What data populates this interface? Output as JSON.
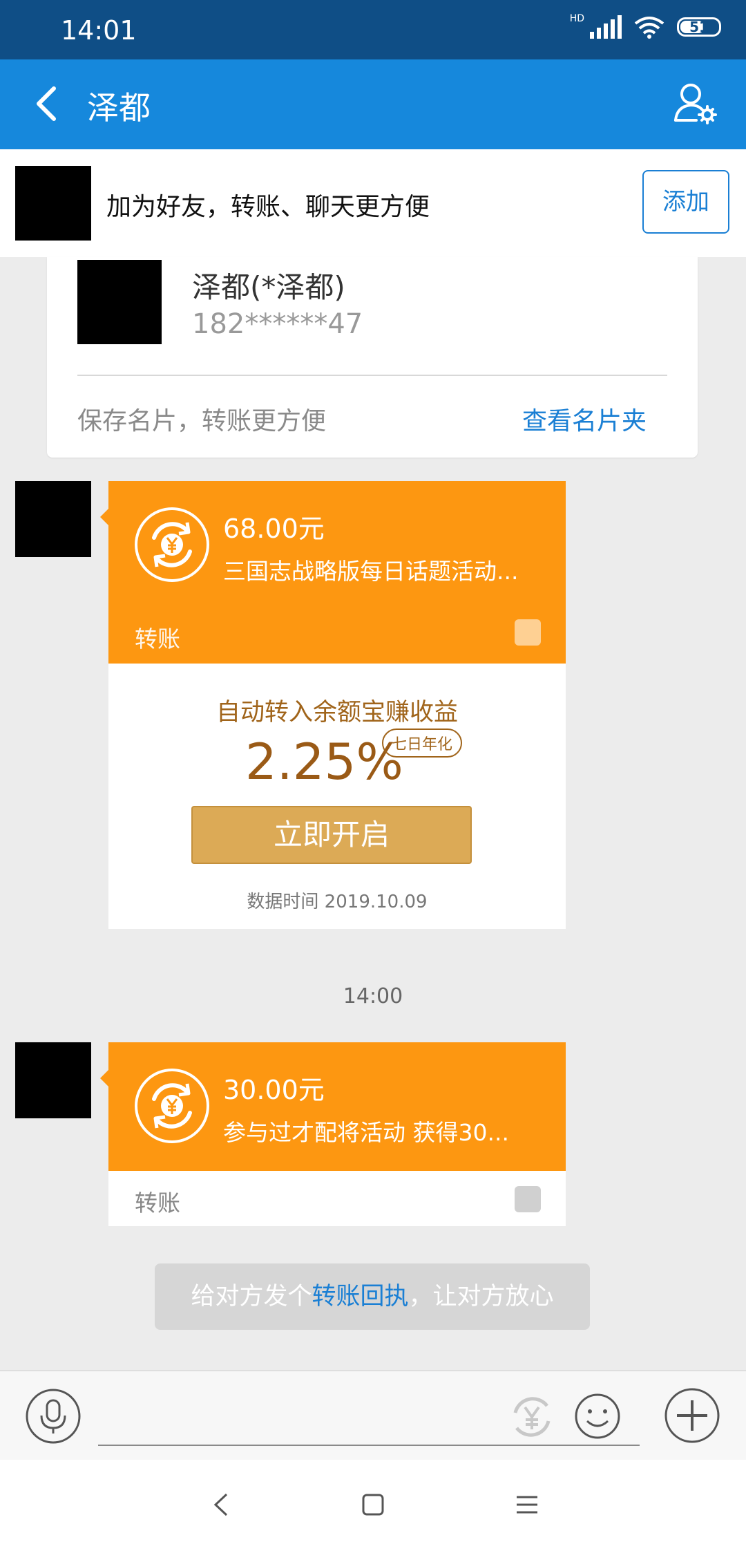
{
  "status_bar": {
    "time": "14:01",
    "network": "HD",
    "battery": "51"
  },
  "header": {
    "title": "泽都"
  },
  "friend_banner": {
    "text": "加为好友，转账、聊天更方便",
    "add_label": "添加"
  },
  "name_card": {
    "name": "泽都(*泽都)",
    "phone": "182******47",
    "save_text": "保存名片，转账更方便",
    "view_link": "查看名片夹"
  },
  "messages": [
    {
      "amount": "68.00元",
      "description": "三国志战略版每日话题活动...",
      "type_label": "转账",
      "promo": {
        "headline": "自动转入余额宝赚收益",
        "rate": "2.25%",
        "badge": "七日年化",
        "button": "立即开启",
        "data_time": "数据时间 2019.10.09"
      }
    },
    {
      "timestamp": "14:00",
      "amount": "30.00元",
      "description": "参与过才配将活动 获得30...",
      "type_label": "转账"
    }
  ],
  "receipt_hint": {
    "prefix": "给对方发个",
    "link": "转账回执",
    "suffix": "，让对方放心"
  },
  "colors": {
    "accent": "#1688dc",
    "transfer": "#fd9711",
    "status_bar": "#0f4e86"
  },
  "icons": [
    "back-arrow-icon",
    "profile-settings-icon",
    "transfer-coin-icon",
    "alipay-icon",
    "microphone-icon",
    "yen-transfer-icon",
    "emoji-icon",
    "plus-icon",
    "nav-back-icon",
    "nav-home-icon",
    "nav-menu-icon"
  ]
}
